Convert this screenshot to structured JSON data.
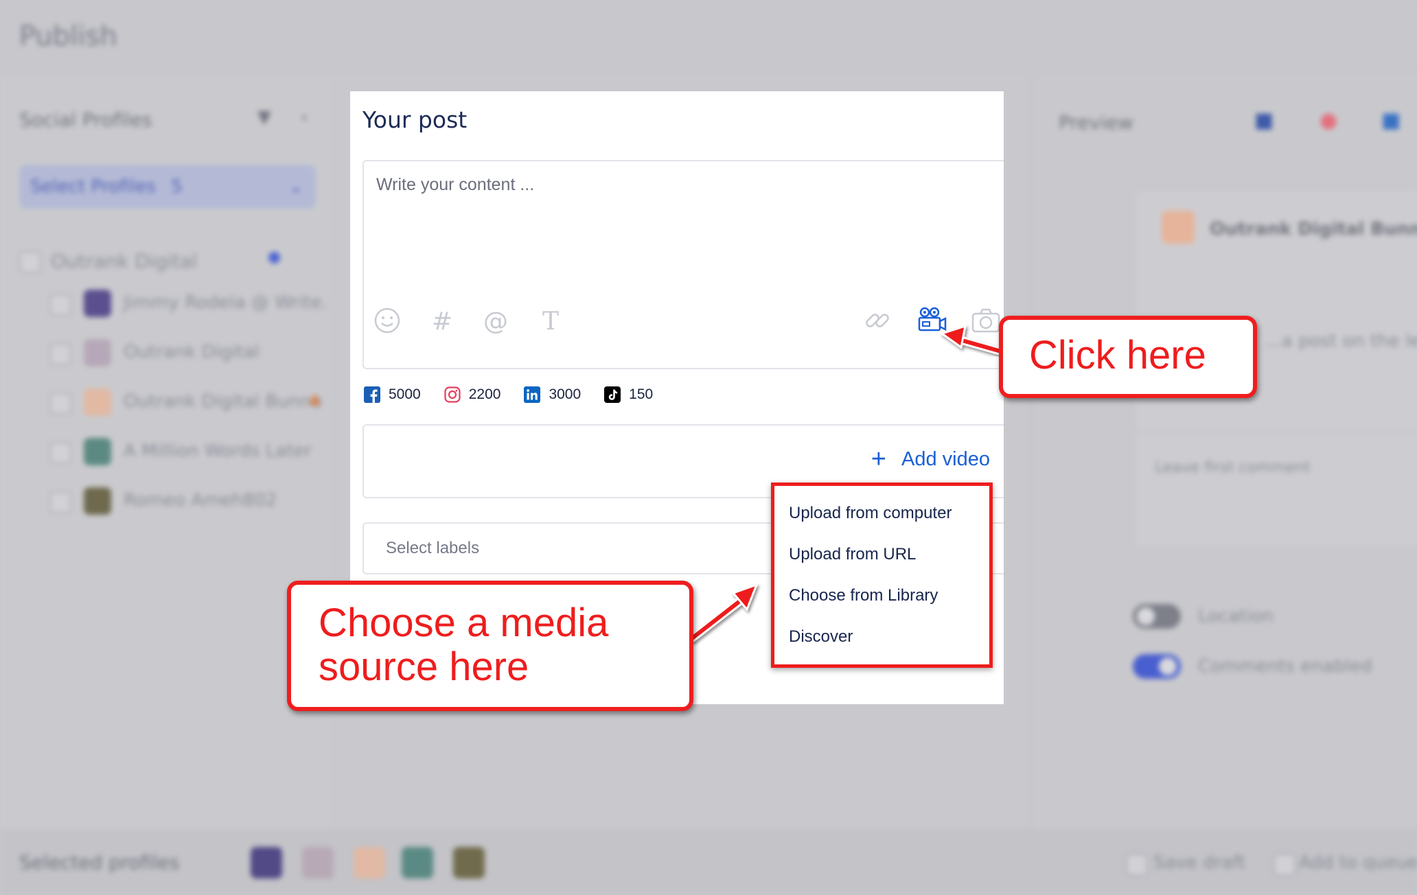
{
  "background": {
    "app_title": "Publish",
    "left_panel": {
      "heading": "Social Profiles",
      "select_button": "Select Profiles",
      "select_count": "5",
      "group_name": "Outrank Digital",
      "profiles": [
        "Jimmy Rodela @ Write...",
        "Outrank Digital",
        "Outrank Digital Bunne",
        "A Million Words Later",
        "Romeo Ameh802"
      ]
    },
    "right_panel": {
      "heading": "Preview",
      "profile_name": "Outrank Digital Bunne",
      "preview_text": "...a post on the le",
      "comment_placeholder": "Leave first comment",
      "toggle_location": "Location",
      "toggle_comments": "Comments enabled"
    },
    "bottom_bar": {
      "label": "Selected profiles",
      "save_draft": "Save draft",
      "add_to_queue": "Add to queue"
    }
  },
  "post": {
    "title": "Your post",
    "content_placeholder": "Write your content ...",
    "counters": [
      {
        "network": "facebook",
        "value": "5000",
        "color": "#1a5fb4"
      },
      {
        "network": "instagram",
        "value": "2200",
        "color": "#e4405f"
      },
      {
        "network": "linkedin",
        "value": "3000",
        "color": "#0a66c2"
      },
      {
        "network": "tiktok",
        "value": "150",
        "color": "#000000"
      }
    ],
    "add_video_label": "Add video",
    "labels_placeholder": "Select labels"
  },
  "media_menu": {
    "items": [
      "Upload from computer",
      "Upload from URL",
      "Choose from Library",
      "Discover"
    ]
  },
  "annotations": {
    "click_here": "Click here",
    "choose_line1": "Choose a media",
    "choose_line2": "source here",
    "color": "#ee1d1d"
  },
  "colors": {
    "accent": "#1a5fd6",
    "title": "#1b2a57",
    "muted_icon": "#c8cad2"
  }
}
